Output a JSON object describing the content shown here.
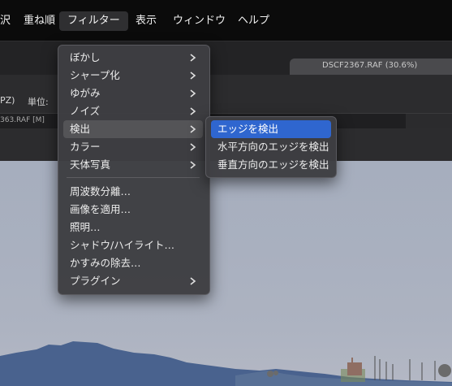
{
  "menubar": {
    "items": [
      {
        "label": "沢",
        "name": "menubar-partial-item"
      },
      {
        "label": "重ね順",
        "name": "menubar-arrange"
      },
      {
        "label": "フィルター",
        "name": "menubar-filter"
      },
      {
        "label": "表示",
        "name": "menubar-view"
      },
      {
        "label": "ウィンドウ",
        "name": "menubar-window"
      },
      {
        "label": "ヘルプ",
        "name": "menubar-help"
      }
    ]
  },
  "document": {
    "tab_title": "DSCF2367.RAF (30.6%)",
    "options_left": "PZ)",
    "units_label": "単位:",
    "layer_label": "363.RAF [M]"
  },
  "filter_menu": {
    "items": [
      {
        "label": "ぼかし",
        "submenu": true
      },
      {
        "label": "シャープ化",
        "submenu": true
      },
      {
        "label": "ゆがみ",
        "submenu": true
      },
      {
        "label": "ノイズ",
        "submenu": true
      },
      {
        "label": "検出",
        "submenu": true,
        "highlighted": true
      },
      {
        "label": "カラー",
        "submenu": true
      },
      {
        "label": "天体写真",
        "submenu": true
      },
      {
        "label": "周波数分離…",
        "submenu": false
      },
      {
        "label": "画像を適用…",
        "submenu": false
      },
      {
        "label": "照明…",
        "submenu": false
      },
      {
        "label": "シャドウ/ハイライト…",
        "submenu": false
      },
      {
        "label": "かすみの除去…",
        "submenu": false
      },
      {
        "label": "プラグイン",
        "submenu": true
      }
    ]
  },
  "detect_submenu": {
    "items": [
      {
        "label": "エッジを検出",
        "selected": true
      },
      {
        "label": "水平方向のエッジを検出",
        "selected": false
      },
      {
        "label": "垂直方向のエッジを検出",
        "selected": false
      }
    ]
  },
  "colors": {
    "menubar_bg": "#0b0b0b",
    "menu_bg": "#3e3e42",
    "selection": "#2f66cf",
    "highlight": "#545457"
  }
}
